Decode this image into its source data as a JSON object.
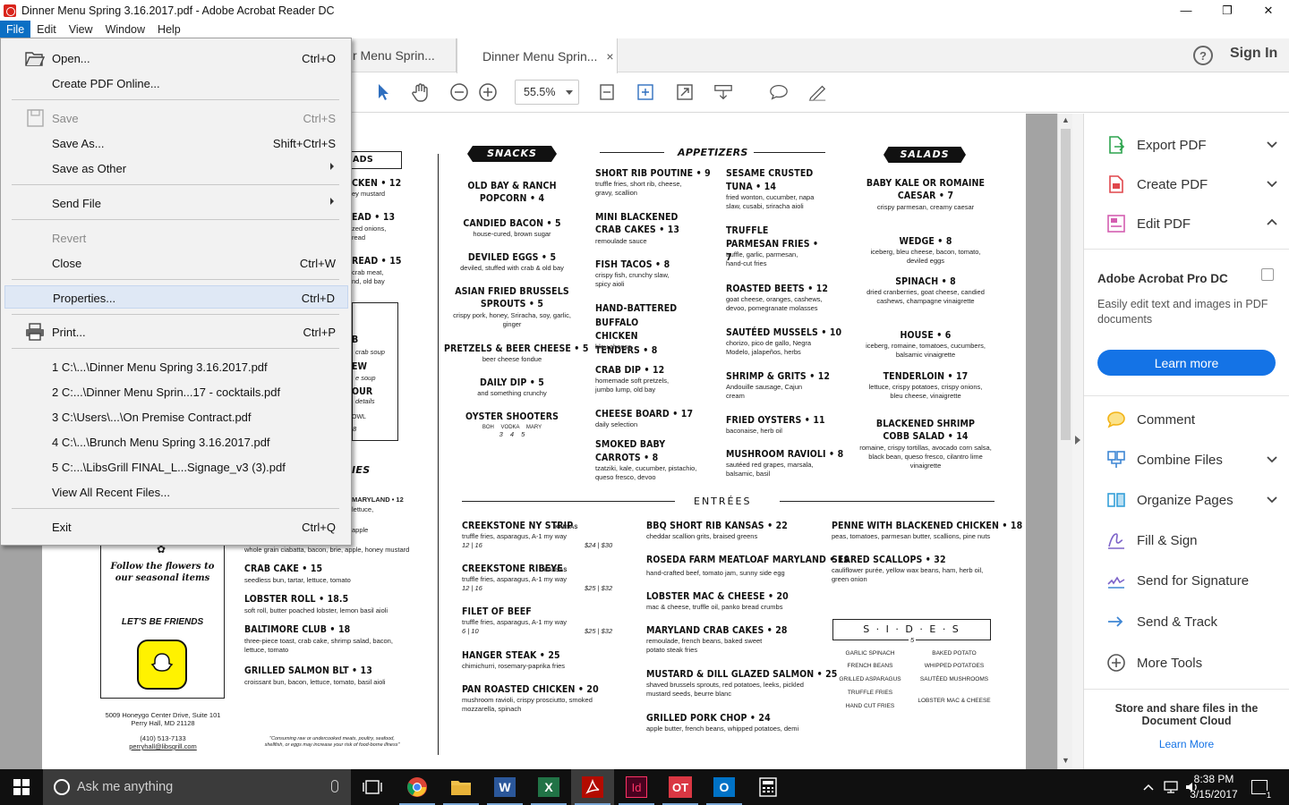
{
  "window": {
    "title": "Dinner Menu Spring 3.16.2017.pdf - Adobe Acrobat Reader DC",
    "minimize": "—",
    "maximize": "❐",
    "close": "✕"
  },
  "menubar": {
    "items": [
      "File",
      "Edit",
      "View",
      "Window",
      "Help"
    ]
  },
  "tabs": [
    {
      "label": "r Menu Sprin..."
    },
    {
      "label": "Dinner Menu Sprin...",
      "close": "×"
    }
  ],
  "header": {
    "help": "?",
    "signin": "Sign In"
  },
  "toolbar": {
    "zoom": "55.5%"
  },
  "file_menu": {
    "open": {
      "label": "Open...",
      "shortcut": "Ctrl+O"
    },
    "create_online": {
      "label": "Create PDF Online..."
    },
    "save": {
      "label": "Save",
      "shortcut": "Ctrl+S"
    },
    "save_as": {
      "label": "Save As...",
      "shortcut": "Shift+Ctrl+S"
    },
    "save_other": {
      "label": "Save as Other"
    },
    "send_file": {
      "label": "Send File"
    },
    "revert": {
      "label": "Revert"
    },
    "close": {
      "label": "Close",
      "shortcut": "Ctrl+W"
    },
    "properties": {
      "label": "Properties...",
      "shortcut": "Ctrl+D"
    },
    "print": {
      "label": "Print...",
      "shortcut": "Ctrl+P"
    },
    "recent": [
      "1 C:\\...\\Dinner Menu Spring 3.16.2017.pdf",
      "2 C:...\\Dinner Menu Sprin...17 - cocktails.pdf",
      "3 C:\\Users\\...\\On Premise Contract.pdf",
      "4 C:\\...\\Brunch Menu Spring 3.16.2017.pdf",
      "5 C:...\\LibsGrill FINAL_L...Signage_v3 (3).pdf"
    ],
    "view_all": {
      "label": "View All Recent Files..."
    },
    "exit": {
      "label": "Exit",
      "shortcut": "Ctrl+Q"
    }
  },
  "menu": {
    "left_fragments": {
      "heading_ads": "ADS",
      "ken": "CKEN • 12",
      "ken_sub": "ey mustard",
      "ead": "EAD • 13",
      "ead_sub1": "zed onions,",
      "ead_sub2": "read",
      "read": "READ • 15",
      "read_sub1": "crab meat,",
      "read_sub2": "nd, old bay",
      "b_letter": "B",
      "b_sub": "crab soup",
      "ew": "EW",
      "ew_sub": "e soup",
      "our": "OUR",
      "our_sub": "details",
      "owl": "OWL",
      "owl_num": "8",
      "ies": "IES",
      "maryland": "MARYLAND • 12",
      "lettuce": "lettuce,",
      "apple_line": "apple",
      "follow": "Follow the flowers to our seasonal items",
      "friends": "LET'S BE FRIENDS",
      "address1": "5009 Honeygo Center Drive, Suite 101",
      "address2": "Perry Hall, MD 21128",
      "phone": "(410) 513-7133",
      "email": "perryhall@libsgrill.com",
      "disclaimer": "\"Consuming raw or undercooked meats, poultry, seafood, shellfish, or eggs may increase your risk of food-borne illness\""
    },
    "sandwiches": [
      {
        "name": "",
        "desc": "whole grain ciabatta, bacon, brie, apple, honey mustard"
      },
      {
        "name": "CRAB CAKE • 15",
        "desc": "seedless bun, tartar, lettuce, tomato"
      },
      {
        "name": "LOBSTER ROLL • 18.5",
        "desc": "soft roll, butter poached lobster, lemon basil aioli"
      },
      {
        "name": "BALTIMORE CLUB • 18",
        "desc": "three-piece toast, crab cake, shrimp salad, bacon, lettuce, tomato"
      },
      {
        "name": "GRILLED SALMON BLT • 13",
        "desc": "croissant bun, bacon, lettuce, tomato, basil aioli"
      }
    ],
    "snacks_heading": "SNACKS",
    "snacks": [
      {
        "name": "OLD BAY & RANCH POPCORN • 4",
        "desc": ""
      },
      {
        "name": "CANDIED BACON • 5",
        "desc": "house-cured, brown sugar"
      },
      {
        "name": "DEVILED EGGS • 5",
        "desc": "deviled, stuffed with crab & old bay"
      },
      {
        "name": "ASIAN FRIED BRUSSELS SPROUTS • 5",
        "desc": "crispy pork, honey, Sriracha, soy, garlic, ginger"
      },
      {
        "name": "PRETZELS & BEER CHEESE • 5",
        "desc": "beer cheese fondue"
      },
      {
        "name": "DAILY DIP • 5",
        "desc": "and something crunchy"
      },
      {
        "name": "OYSTER SHOOTERS",
        "desc": "BOH  VODKA  MARY"
      }
    ],
    "oyster_prices": "3     4     5",
    "appetizers_heading": "APPETIZERS",
    "appetizers_left": [
      {
        "name": "SHORT RIB POUTINE • 9",
        "desc": "truffle fries, short rib, cheese, gravy, scallion"
      },
      {
        "name": "MINI BLACKENED CRAB CAKES • 13",
        "desc": "remoulade sauce"
      },
      {
        "name": "FISH TACOS • 8",
        "desc": "crispy fish, crunchy slaw, spicy aioli"
      },
      {
        "name": "HAND-BATTERED BUFFALO CHICKEN TENDERS • 8",
        "desc": "bleu cheese"
      },
      {
        "name": "CRAB DIP • 12",
        "desc": "homemade soft pretzels, jumbo lump, old bay"
      },
      {
        "name": "CHEESE BOARD • 17",
        "desc": "daily selection"
      },
      {
        "name": "SMOKED BABY CARROTS • 8",
        "desc": "tzatziki, kale, cucumber, pistachio, queso fresco, devoo"
      }
    ],
    "appetizers_right": [
      {
        "name": "SESAME CRUSTED TUNA • 14",
        "desc": "fried wonton, cucumber, napa slaw, cusabi, sriracha aioli"
      },
      {
        "name": "TRUFFLE PARMESAN FRIES • 7",
        "desc": "truffle, garlic, parmesan, hand-cut fries"
      },
      {
        "name": "ROASTED BEETS • 12",
        "desc": "goat cheese, oranges, cashews, devoo, pomegranate molasses"
      },
      {
        "name": "SAUTÉED MUSSELS • 10",
        "desc": "chorizo, pico de gallo, Negra Modelo, jalapeños, herbs"
      },
      {
        "name": "SHRIMP & GRITS • 12",
        "desc": "Andouille sausage, Cajun cream"
      },
      {
        "name": "FRIED OYSTERS • 11",
        "desc": "baconaise, herb oil"
      },
      {
        "name": "MUSHROOM RAVIOLI • 8",
        "desc": "sautéed red grapes, marsala, balsamic, basil"
      }
    ],
    "salads_heading": "SALADS",
    "salads": [
      {
        "name": "BABY KALE OR ROMAINE CAESAR • 7",
        "desc": "crispy parmesan, creamy caesar"
      },
      {
        "name": "WEDGE • 8",
        "desc": "iceberg, bleu cheese, bacon, tomato, deviled eggs"
      },
      {
        "name": "SPINACH • 8",
        "desc": "dried cranberries, goat cheese, candied cashews, champagne vinaigrette"
      },
      {
        "name": "HOUSE • 6",
        "desc": "iceberg, romaine, tomatoes, cucumbers, balsamic vinaigrette"
      },
      {
        "name": "TENDERLOIN • 17",
        "desc": "lettuce, crispy potatoes, crispy onions, bleu cheese, vinaigrette"
      },
      {
        "name": "BLACKENED SHRIMP COBB SALAD • 14",
        "desc": "romaine, crispy tortillas, avocado corn salsa, black bean, queso fresco, cilantro lime vinaigrette"
      }
    ],
    "entrees_heading": "ENTRÉES",
    "entrees_col1": [
      {
        "name": "CREEKSTONE NY STRIP",
        "tag": "KANSAS",
        "desc": "truffle fries, asparagus, A-1 my way",
        "sizes": "12 | 16",
        "prices": "$24 | $30"
      },
      {
        "name": "CREEKSTONE RIBEYE",
        "tag": "KANSAS",
        "desc": "truffle fries, asparagus, A-1 my way",
        "sizes": "12 | 16",
        "prices": "$25 | $32"
      },
      {
        "name": "FILET OF BEEF",
        "tag": "",
        "desc": "truffle fries, asparagus, A-1 my way",
        "sizes": "6 | 10",
        "prices": "$25 | $32"
      },
      {
        "name": "HANGER STEAK • 25",
        "tag": "",
        "desc": "chimichurri, rosemary-paprika fries",
        "sizes": "",
        "prices": ""
      },
      {
        "name": "PAN ROASTED CHICKEN • 20",
        "tag": "",
        "desc": "mushroom ravioli, crispy prosciutto, smoked mozzarella, spinach",
        "sizes": "",
        "prices": ""
      }
    ],
    "entrees_col2": [
      {
        "name": "BBQ SHORT RIB KANSAS • 22",
        "desc": "cheddar scallion grits, braised greens"
      },
      {
        "name": "ROSEDA FARM MEATLOAF MARYLAND • 19",
        "desc": "hand-crafted beef, tomato jam, sunny side egg"
      },
      {
        "name": "LOBSTER MAC & CHEESE • 20",
        "desc": "mac & cheese, truffle oil, panko bread crumbs"
      },
      {
        "name": "MARYLAND CRAB CAKES • 28",
        "desc": "remoulade, french beans, baked sweet potato steak fries"
      },
      {
        "name": "MUSTARD & DILL GLAZED SALMON • 25",
        "desc": "shaved brussels sprouts, red potatoes, leeks, pickled mustard seeds, beurre blanc"
      },
      {
        "name": "GRILLED PORK CHOP • 24",
        "desc": "apple butter, french beans, whipped potatoes, demi"
      }
    ],
    "entrees_col3": [
      {
        "name": "PENNE WITH BLACKENED CHICKEN • 18",
        "desc": "peas, tomatoes, parmesan butter, scallions, pine nuts"
      },
      {
        "name": "SEARED SCALLOPS • 32",
        "desc": "cauliflower purée, yellow wax beans, ham, herb oil, green onion"
      }
    ],
    "sides_heading": "S · I · D · E · S",
    "sides_price": "5",
    "sides_left": [
      "GARLIC SPINACH",
      "FRENCH BEANS",
      "GRILLED ASPARAGUS",
      "TRUFFLE FRIES",
      "HAND CUT FRIES"
    ],
    "sides_right": [
      "BAKED POTATO",
      "WHIPPED POTATOES",
      "SAUTÉED MUSHROOMS",
      "LOBSTER MAC & CHEESE"
    ]
  },
  "right_panel": {
    "tools_top": [
      {
        "label": "Export PDF",
        "icon": "export-pdf-icon",
        "color": "#2da44e"
      },
      {
        "label": "Create PDF",
        "icon": "create-pdf-icon",
        "color": "#e0474c"
      },
      {
        "label": "Edit PDF",
        "icon": "edit-pdf-icon",
        "color": "#d45eb0"
      }
    ],
    "promo": {
      "title": "Adobe Acrobat Pro DC",
      "body": "Easily edit text and images in PDF documents",
      "button": "Learn more"
    },
    "tools_bottom": [
      {
        "label": "Comment",
        "icon": "comment-icon",
        "color": "#f2b316"
      },
      {
        "label": "Combine Files",
        "icon": "combine-files-icon",
        "color": "#3e86d4"
      },
      {
        "label": "Organize Pages",
        "icon": "organize-pages-icon",
        "color": "#35a0d9"
      },
      {
        "label": "Fill & Sign",
        "icon": "fill-sign-icon",
        "color": "#7d63c9"
      },
      {
        "label": "Send for Signature",
        "icon": "send-signature-icon",
        "color": "#7d63c9"
      },
      {
        "label": "Send & Track",
        "icon": "send-track-icon",
        "color": "#3e86d4"
      },
      {
        "label": "More Tools",
        "icon": "more-tools-icon",
        "color": "#555555"
      }
    ],
    "bottom_text": "Store and share files in the Document Cloud",
    "bottom_link": "Learn More"
  },
  "taskbar": {
    "search_placeholder": "Ask me anything",
    "time": "8:38 PM",
    "date": "3/15/2017",
    "notif_count": "1",
    "indesign_label": "Id",
    "opentable_label": "OT",
    "word_label": "W",
    "excel_label": "X",
    "outlook_label": "O"
  },
  "colors": {
    "menu_highlight": "#0b6fc4",
    "learn_button": "#1473e6",
    "doc_background": "#a3a3a3"
  }
}
